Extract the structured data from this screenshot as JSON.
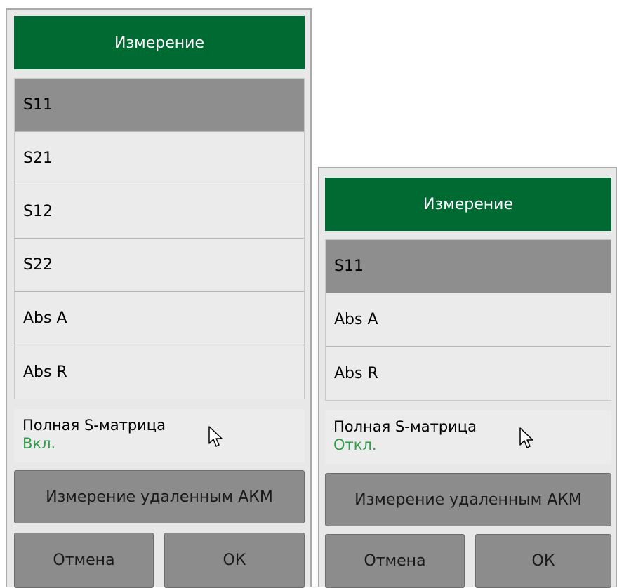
{
  "colors": {
    "header_bg": "#006a33",
    "selected_bg": "#8e8e8e",
    "status_value": "#2e9c4a",
    "button_bg": "#8c8c8c"
  },
  "left_dialog": {
    "title": "Измерение",
    "items": [
      {
        "label": "S11",
        "selected": true
      },
      {
        "label": "S21",
        "selected": false
      },
      {
        "label": "S12",
        "selected": false
      },
      {
        "label": "S22",
        "selected": false
      },
      {
        "label": "Abs A",
        "selected": false
      },
      {
        "label": "Abs R",
        "selected": false
      }
    ],
    "option": {
      "label": "Полная S-матрица",
      "value": "Вкл."
    },
    "remote_button": "Измерение удаленным АКМ",
    "cancel_button": "Отмена",
    "ok_button": "ОК"
  },
  "right_dialog": {
    "title": "Измерение",
    "items": [
      {
        "label": "S11",
        "selected": true
      },
      {
        "label": "Abs A",
        "selected": false
      },
      {
        "label": "Abs R",
        "selected": false
      }
    ],
    "option": {
      "label": "Полная S-матрица",
      "value": "Откл."
    },
    "remote_button": "Измерение удаленным АКМ",
    "cancel_button": "Отмена",
    "ok_button": "ОК"
  }
}
